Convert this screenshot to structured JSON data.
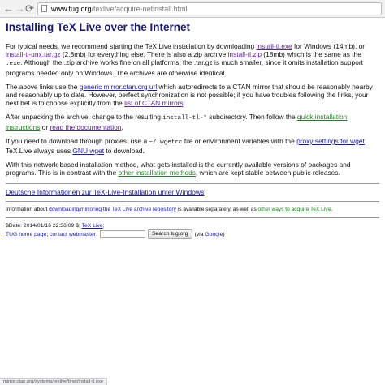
{
  "browser": {
    "back_glyph": "←",
    "forward_glyph": "→",
    "reload_glyph": "⟳",
    "url_host": "www.tug.org",
    "url_path": "/texlive/acquire-netinstall.html"
  },
  "page": {
    "title": "Installing TeX Live over the Internet",
    "p1": {
      "t1": "For typical needs, we recommend starting the TeX Live installation by downloading ",
      "l1": "install-tl.exe",
      "t2": " for Windows (14mb), or ",
      "l2": "install-tl-unx.tar.gz",
      "t3": " (2.8mb) for everything else. There is also a zip archive ",
      "l3": "install-tl.zip",
      "t4": " (18mb) which is the same as the ",
      "c1": ".exe",
      "t5": ". Although the .zip archive works fine on all platforms, the .tar.gz is much smaller, since it omits installation support programs needed only on Windows. The archives are otherwise identical."
    },
    "p2": {
      "t1": "The above links use the ",
      "l1": "generic mirror.ctan.org url",
      "t2": " which autoredirects to a CTAN mirror that should be reasonably nearby and reasonably up to date. However, perfect synchronization is not possible; if you have troubles following the links, your best bet is to choose explicitly from the ",
      "l2": "list of CTAN mirrors",
      "t3": "."
    },
    "p3": {
      "t1": "After unpacking the archive, change to the resulting ",
      "c1": "install-tl-*",
      "t2": " subdirectory. Then follow the ",
      "l1": "quick installation instructions",
      "t3": " or ",
      "l2": "read the documentation",
      "t4": "."
    },
    "p4": {
      "t1": "If you need to download through proxies, use a ",
      "c1": "~/.wgetrc",
      "t2": " file or environment variables with the ",
      "l1": "proxy settings for wget",
      "t3": ". TeX Live always uses ",
      "l2": "GNU wget",
      "t4": " to download."
    },
    "p5": {
      "t1": "With this network-based installation method, what gets installed is the currently available versions of packages and programs. This is in contrast with the ",
      "l1": "other installation methods",
      "t2": ", which are kept stable between public releases."
    },
    "deutsch_link": "Deutsche Informationen zur TeX-Live-Installation unter Windows",
    "info": {
      "t1": "Information about ",
      "l1": "downloading/mirroring the TeX Live archive repository",
      "t2": " is available separately, as well as ",
      "l2": "other ways to acquire TeX Live",
      "t3": "."
    }
  },
  "footer": {
    "date_text": "$Date: 2014/01/16 22:56:09 $; ",
    "texlive_link": "TeX Live",
    "texlive_after": ";",
    "home_link": "TUG home page",
    "sep": "; ",
    "contact_link": "contact webmaster",
    "contact_after": ";",
    "search_button": "Search tug.org",
    "via_before": " (via ",
    "google_link": "Google",
    "via_after": ")"
  },
  "status_bar": {
    "text": "mirror.ctan.org/systems/texlive/tlnet/install-tl.exe"
  }
}
